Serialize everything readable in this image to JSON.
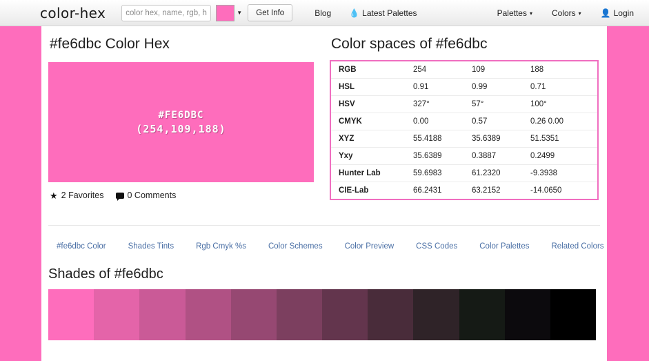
{
  "navbar": {
    "brand": "color-hex",
    "search": {
      "placeholder": "color hex, name, rgb, h",
      "value": ""
    },
    "swatch_color": "#fe6dbc",
    "caret_glyph": "▼",
    "get_info_label": "Get Info",
    "left_links": [
      {
        "label": "Blog",
        "icon": ""
      },
      {
        "label": "Latest Palettes",
        "icon": "💧"
      }
    ],
    "right_links": [
      {
        "label": "Palettes",
        "caret": "▾",
        "icon": ""
      },
      {
        "label": "Colors",
        "caret": "▾",
        "icon": ""
      },
      {
        "label": "Login",
        "caret": "",
        "icon": "👤"
      }
    ]
  },
  "main": {
    "page_title": "#fe6dbc Color Hex",
    "swatch": {
      "color": "#fe6dbc",
      "hex_label": "#FE6DBC",
      "rgb_label": "(254,109,188)"
    },
    "meta": {
      "favorites": "2 Favorites",
      "comments": "0 Comments",
      "star_glyph": "★"
    },
    "spaces_title": "Color spaces of #fe6dbc",
    "spaces_border_color": "#f06ec0",
    "spaces_rows": [
      {
        "label": "RGB",
        "v1": "254",
        "v2": "109",
        "v3": "188"
      },
      {
        "label": "HSL",
        "v1": "0.91",
        "v2": "0.99",
        "v3": "0.71"
      },
      {
        "label": "HSV",
        "v1": "327°",
        "v2": "57°",
        "v3": "100°"
      },
      {
        "label": "CMYK",
        "v1": "0.00",
        "v2": "0.57",
        "v3": "0.26   0.00"
      },
      {
        "label": "XYZ",
        "v1": "55.4188",
        "v2": "35.6389",
        "v3": "51.5351"
      },
      {
        "label": "Yxy",
        "v1": "35.6389",
        "v2": "0.3887",
        "v3": "0.2499"
      },
      {
        "label": "Hunter Lab",
        "v1": "59.6983",
        "v2": "61.2320",
        "v3": "-9.3938"
      },
      {
        "label": "CIE-Lab",
        "v1": "66.2431",
        "v2": "63.2152",
        "v3": "-14.0650"
      }
    ],
    "tabs": [
      {
        "label": "#fe6dbc Color"
      },
      {
        "label": "Shades Tints"
      },
      {
        "label": "Rgb Cmyk %s"
      },
      {
        "label": "Color Schemes"
      },
      {
        "label": "Color Preview"
      },
      {
        "label": "CSS Codes"
      },
      {
        "label": "Color Palettes"
      },
      {
        "label": "Related Colors"
      }
    ],
    "shades_title": "Shades of #fe6dbc",
    "shades": [
      "#fe6dbc",
      "#e464a9",
      "#ca5a97",
      "#b05184",
      "#964872",
      "#7c3f5f",
      "#63354d",
      "#492c3a",
      "#2f2328",
      "#151a15",
      "#0c0a0d",
      "#000000"
    ]
  }
}
